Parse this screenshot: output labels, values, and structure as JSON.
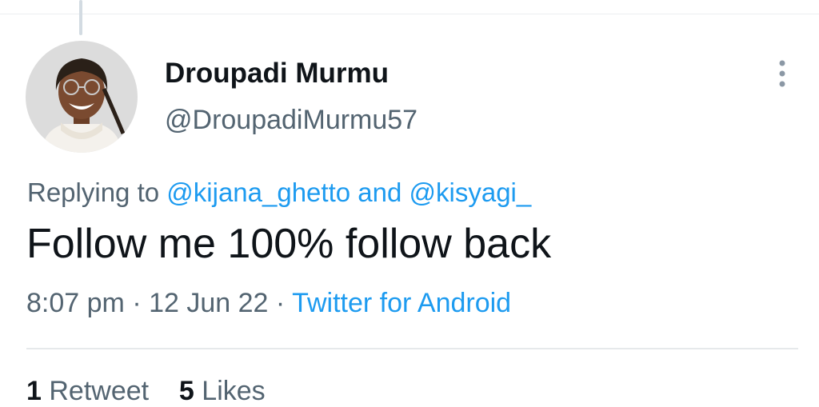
{
  "tweet": {
    "author": {
      "display_name": "Droupadi Murmu",
      "handle": "@DroupadiMurmu57"
    },
    "reply_context": {
      "label": "Replying to",
      "mentions": [
        "@kijana_ghetto",
        "@kisyagi_"
      ],
      "conjunction": "and"
    },
    "text": "Follow me 100% follow back",
    "meta": {
      "time": "8:07 pm",
      "separator": "·",
      "date": "12 Jun 22",
      "source": "Twitter for Android"
    },
    "stats": {
      "retweets_count": "1",
      "retweets_label": "Retweet",
      "likes_count": "5",
      "likes_label": "Likes"
    }
  },
  "icons": {
    "more": "more-vertical-icon"
  },
  "colors": {
    "link": "#1d9bf0",
    "secondary_text": "#536471",
    "primary_text": "#0f1419"
  }
}
